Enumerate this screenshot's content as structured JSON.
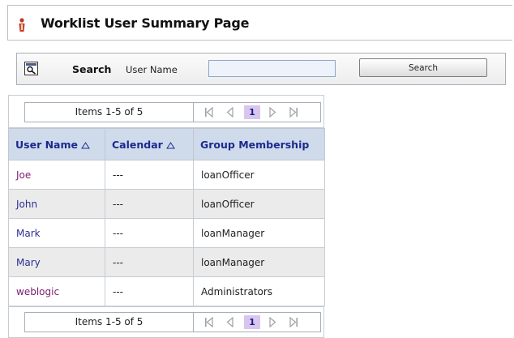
{
  "page": {
    "title": "Worklist User Summary Page",
    "title_icon": "worklist-user-icon"
  },
  "search": {
    "icon": "search-panel-icon",
    "heading": "Search",
    "field_label": "User Name",
    "field_value": "",
    "button_label": "Search"
  },
  "pager": {
    "summary": "Items 1-5 of 5",
    "current_page": "1",
    "icons": [
      "first-page-icon",
      "previous-page-icon",
      "next-page-icon",
      "last-page-icon"
    ]
  },
  "table": {
    "columns": [
      {
        "label": "User Name",
        "sortable": true
      },
      {
        "label": "Calendar",
        "sortable": true
      },
      {
        "label": "Group Membership",
        "sortable": false
      }
    ],
    "rows": [
      {
        "user": "Joe",
        "calendar": "---",
        "group": "loanOfficer"
      },
      {
        "user": "John",
        "calendar": "---",
        "group": "loanOfficer"
      },
      {
        "user": "Mark",
        "calendar": "---",
        "group": "loanManager"
      },
      {
        "user": "Mary",
        "calendar": "---",
        "group": "loanManager"
      },
      {
        "user": "weblogic",
        "calendar": "---",
        "group": "Administrators"
      }
    ]
  },
  "colors": {
    "header_bg": "#cfdbeb",
    "header_text": "#1b2a8f",
    "link": "#2e2f96",
    "visited_link": "#7a1f6e",
    "current_page_bg": "#d9c6ee",
    "alt_row_bg": "#ebebeb"
  }
}
